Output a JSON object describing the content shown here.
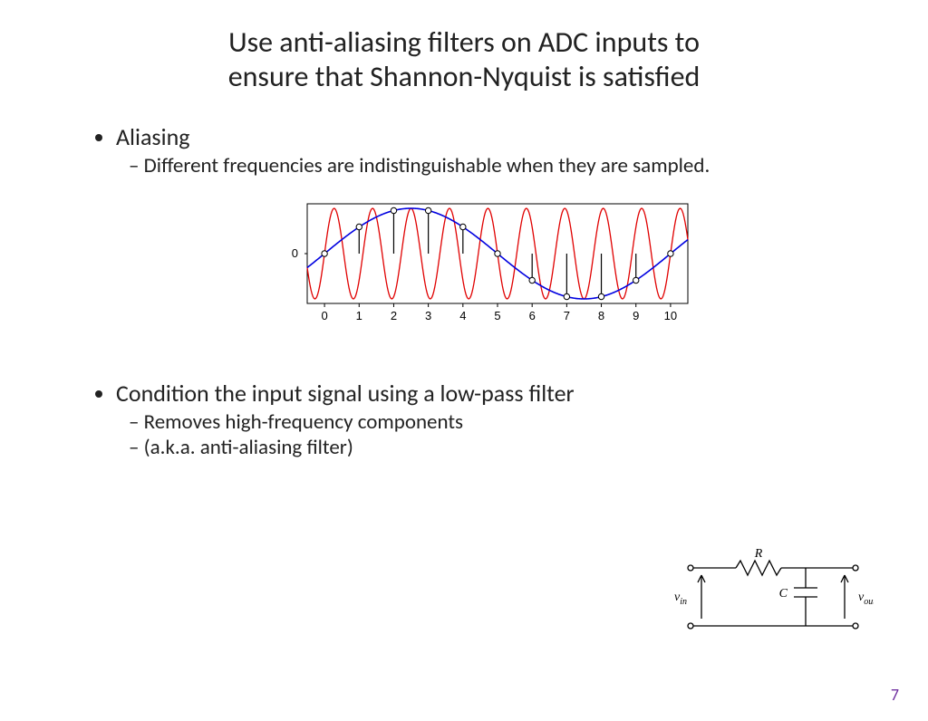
{
  "title_line1": "Use anti-aliasing filters on ADC inputs to",
  "title_line2": "ensure that Shannon-Nyquist is satisfied",
  "bullet1": "Aliasing",
  "bullet1_sub1": "Different frequencies are indistinguishable when they are sampled.",
  "bullet2": "Condition the input signal using a low-pass filter",
  "bullet2_sub1": "Removes high-frequency components",
  "bullet2_sub2": "(a.k.a. anti-aliasing filter)",
  "page_number": "7",
  "chart_data": {
    "type": "line",
    "title": "",
    "xlabel": "",
    "ylabel": "",
    "xlim": [
      -0.5,
      10.5
    ],
    "ylim": [
      -1.1,
      1.1
    ],
    "xticks": [
      0,
      1,
      2,
      3,
      4,
      5,
      6,
      7,
      8,
      9,
      10
    ],
    "yticks": [
      0
    ],
    "series": [
      {
        "name": "high-frequency (red)",
        "freq_cycles_per_unit": 0.9,
        "color": "#e00000"
      },
      {
        "name": "aliased low-frequency (blue)",
        "freq_cycles_per_unit": 0.1,
        "color": "#0000e0"
      }
    ],
    "sample_x": [
      0,
      1,
      2,
      3,
      4,
      5,
      6,
      7,
      8,
      9,
      10
    ],
    "sample_y": [
      0.0,
      0.59,
      0.95,
      0.95,
      0.59,
      0.0,
      -0.59,
      -0.95,
      -0.95,
      -0.59,
      0.0
    ]
  },
  "circuit": {
    "vin_label": "v",
    "vin_sub": "in",
    "vout_label": "v",
    "vout_sub": "out",
    "r_label": "R",
    "c_label": "C"
  }
}
